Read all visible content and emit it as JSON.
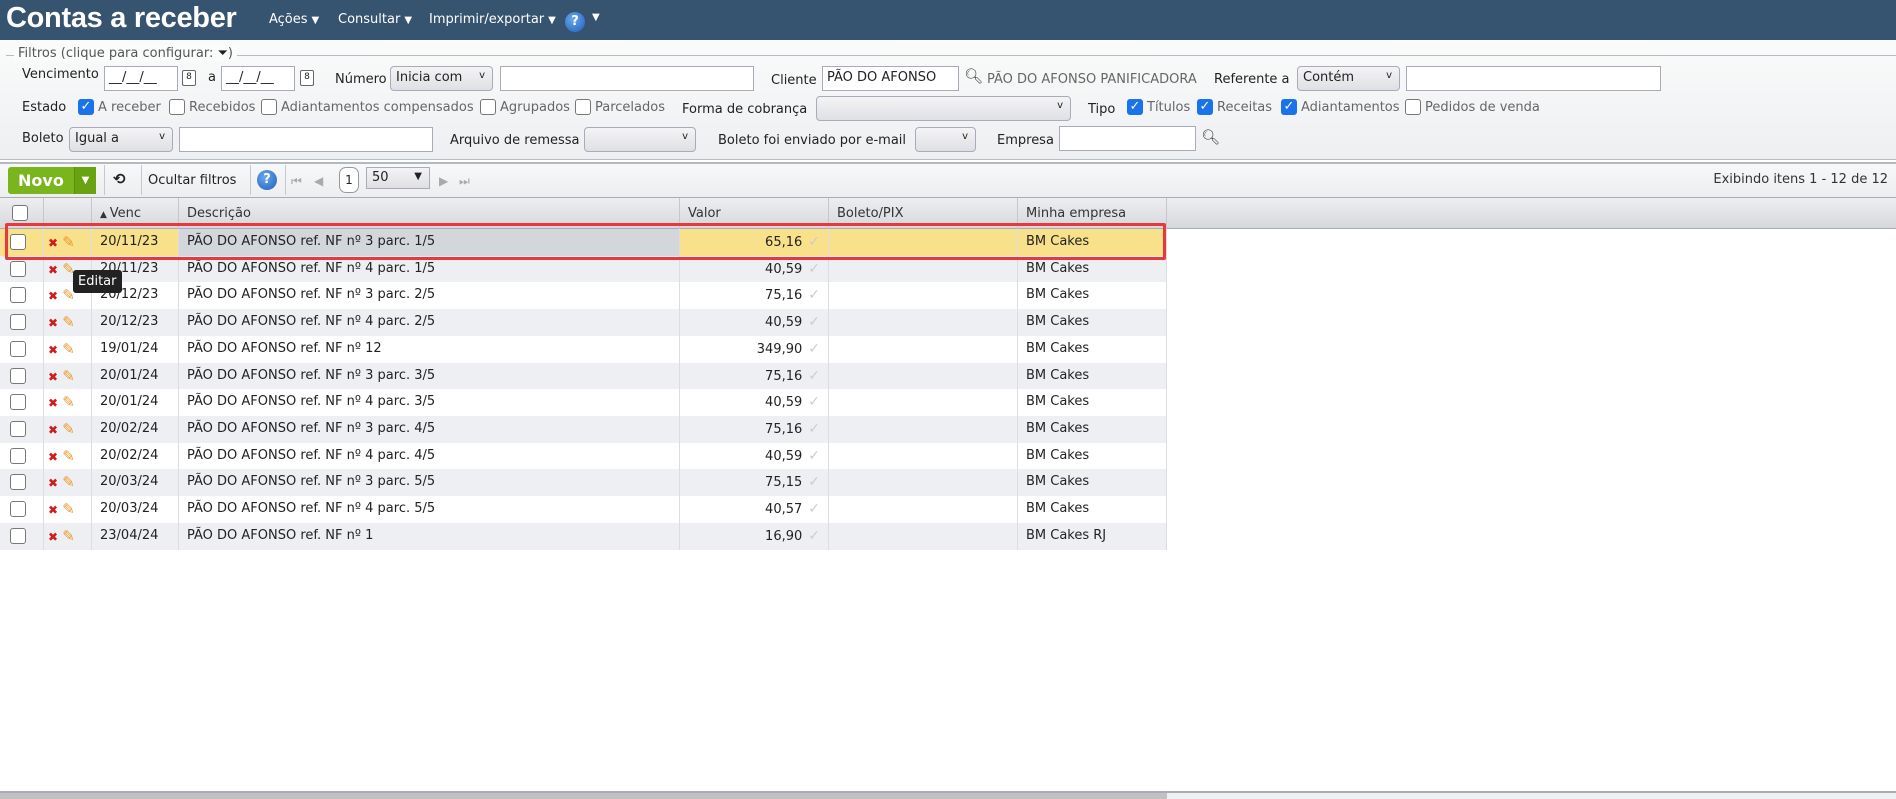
{
  "header": {
    "title": "Contas a receber",
    "menus": [
      "Ações",
      "Consultar",
      "Imprimir/exportar"
    ],
    "help": "?"
  },
  "filters": {
    "legend": "Filtros (clique para configurar:",
    "legend_close": ")",
    "vencimento_label": "Vencimento",
    "venc_from": "__/__/__",
    "venc_to": "__/__/__",
    "a_label": "a",
    "cal": "8",
    "numero_label": "Número",
    "numero_op": "Inicia com",
    "numero_value": "",
    "cliente_label": "Cliente",
    "cliente_value": "PÃO DO AFONSO",
    "cliente_name": "PÃO DO AFONSO PANIFICADORA",
    "referente_label": "Referente a",
    "referente_op": "Contém",
    "referente_value": "",
    "estado_label": "Estado",
    "estado": [
      {
        "label": "A receber",
        "checked": true
      },
      {
        "label": "Recebidos",
        "checked": false
      },
      {
        "label": "Adiantamentos compensados",
        "checked": false
      },
      {
        "label": "Agrupados",
        "checked": false
      },
      {
        "label": "Parcelados",
        "checked": false
      }
    ],
    "forma_label": "Forma de cobrança",
    "forma_value": "",
    "tipo_label": "Tipo",
    "tipo": [
      {
        "label": "Títulos",
        "checked": true
      },
      {
        "label": "Receitas",
        "checked": true
      },
      {
        "label": "Adiantamentos",
        "checked": true
      },
      {
        "label": "Pedidos de venda",
        "checked": false
      }
    ],
    "boleto_label": "Boleto",
    "boleto_op": "Igual a",
    "boleto_value": "",
    "arquivo_label": "Arquivo de remessa",
    "arquivo_value": "",
    "email_label": "Boleto foi enviado por e-mail",
    "email_value": "",
    "empresa_label": "Empresa",
    "empresa_value": ""
  },
  "toolbar": {
    "novo": "Novo",
    "ocultar": "Ocultar filtros",
    "page": "1",
    "page_size": "50",
    "status": "Exibindo itens 1 - 12 de 12"
  },
  "grid": {
    "columns": [
      "Venc",
      "Descrição",
      "Valor",
      "Boleto/PIX",
      "Minha empresa"
    ],
    "rows": [
      {
        "venc": "20/11/23",
        "desc": "PÃO DO AFONSO ref. NF nº 3 parc. 1/5",
        "valor": "65,16",
        "boleto": "",
        "empresa": "BM Cakes"
      },
      {
        "venc": "20/11/23",
        "desc": "PÃO DO AFONSO ref. NF nº 4 parc. 1/5",
        "valor": "40,59",
        "boleto": "",
        "empresa": "BM Cakes"
      },
      {
        "venc": "20/12/23",
        "desc": "PÃO DO AFONSO ref. NF nº 3 parc. 2/5",
        "valor": "75,16",
        "boleto": "",
        "empresa": "BM Cakes"
      },
      {
        "venc": "20/12/23",
        "desc": "PÃO DO AFONSO ref. NF nº 4 parc. 2/5",
        "valor": "40,59",
        "boleto": "",
        "empresa": "BM Cakes"
      },
      {
        "venc": "19/01/24",
        "desc": "PÃO DO AFONSO ref. NF nº 12",
        "valor": "349,90",
        "boleto": "",
        "empresa": "BM Cakes"
      },
      {
        "venc": "20/01/24",
        "desc": "PÃO DO AFONSO ref. NF nº 3 parc. 3/5",
        "valor": "75,16",
        "boleto": "",
        "empresa": "BM Cakes"
      },
      {
        "venc": "20/01/24",
        "desc": "PÃO DO AFONSO ref. NF nº 4 parc. 3/5",
        "valor": "40,59",
        "boleto": "",
        "empresa": "BM Cakes"
      },
      {
        "venc": "20/02/24",
        "desc": "PÃO DO AFONSO ref. NF nº 3 parc. 4/5",
        "valor": "75,16",
        "boleto": "",
        "empresa": "BM Cakes"
      },
      {
        "venc": "20/02/24",
        "desc": "PÃO DO AFONSO ref. NF nº 4 parc. 4/5",
        "valor": "40,59",
        "boleto": "",
        "empresa": "BM Cakes"
      },
      {
        "venc": "20/03/24",
        "desc": "PÃO DO AFONSO ref. NF nº 3 parc. 5/5",
        "valor": "75,15",
        "boleto": "",
        "empresa": "BM Cakes"
      },
      {
        "venc": "20/03/24",
        "desc": "PÃO DO AFONSO ref. NF nº 4 parc. 5/5",
        "valor": "40,57",
        "boleto": "",
        "empresa": "BM Cakes"
      },
      {
        "venc": "23/04/24",
        "desc": "PÃO DO AFONSO ref. NF nº 1",
        "valor": "16,90",
        "boleto": "",
        "empresa": "BM Cakes RJ"
      }
    ]
  },
  "tooltip": "Editar",
  "colors": {
    "header": "#36536f",
    "novo": "#7ab51d",
    "selected": "#f9e08a",
    "highlight": "#e8383d"
  }
}
